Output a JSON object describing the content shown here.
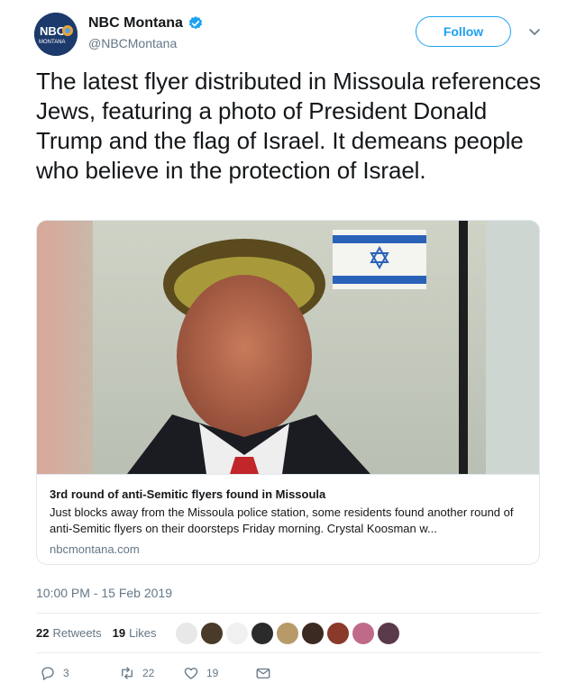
{
  "account": {
    "display_name": "NBC Montana",
    "handle": "@NBCMontana",
    "avatar_text_top": "NBC",
    "avatar_text_bottom": "MONTANA",
    "follow_label": "Follow"
  },
  "tweet": {
    "text": "The latest flyer distributed in Missoula references Jews, featuring a photo of President Donald Trump and the flag of Israel. It demeans people who believe in the protection of Israel."
  },
  "card": {
    "title": "3rd round of anti-Semitic flyers found in Missoula",
    "description": "Just blocks away from the Missoula police station, some residents found another round of anti-Semitic flyers on their doorsteps Friday morning. Crystal Koosman w...",
    "domain": "nbcmontana.com"
  },
  "meta": {
    "timestamp": "10:00 PM - 15 Feb 2019"
  },
  "stats": {
    "retweets_count": "22",
    "retweets_label": "Retweets",
    "likes_count": "19",
    "likes_label": "Likes",
    "liker_colors": [
      "#e8e8e8",
      "#4a3a2a",
      "#f0f0f0",
      "#2b2b2b",
      "#b89a6a",
      "#3a2a20",
      "#8a3a2a",
      "#c06a8a",
      "#5a3a4a"
    ]
  },
  "actions": {
    "reply_count": "3",
    "retweet_count": "22",
    "like_count": "19"
  },
  "colors": {
    "brand_blue": "#1da1f2",
    "text_secondary": "#657786"
  }
}
